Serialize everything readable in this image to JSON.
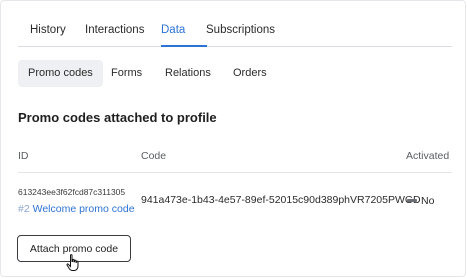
{
  "tabs": [
    {
      "label": "History"
    },
    {
      "label": "Interactions"
    },
    {
      "label": "Data"
    },
    {
      "label": "Subscriptions"
    }
  ],
  "active_tab": "Data",
  "subtabs": [
    {
      "label": "Promo codes"
    },
    {
      "label": "Forms"
    },
    {
      "label": "Relations"
    },
    {
      "label": "Orders"
    }
  ],
  "active_subtab": "Promo codes",
  "section_title": "Promo codes attached to profile",
  "table": {
    "headers": {
      "id": "ID",
      "code": "Code",
      "activated": "Activated"
    },
    "rows": [
      {
        "id": "613243ee3f62fcd87c311305",
        "number": "#2",
        "name": "Welcome promo code",
        "code": "941a473e-1b43-4e57-89ef-52015c90d389phVR7205PWGD",
        "activated": "No",
        "activated_icon": "dash-icon"
      }
    ]
  },
  "attach_button_label": "Attach promo code",
  "colors": {
    "accent": "#2d73d6",
    "text": "#2b2b2b",
    "border": "#3a3c40"
  }
}
